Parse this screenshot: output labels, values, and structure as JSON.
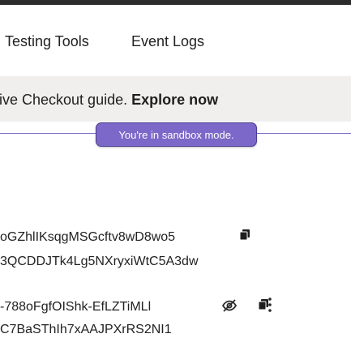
{
  "nav": {
    "items": [
      {
        "label": "Testing Tools"
      },
      {
        "label": "Event Logs"
      }
    ]
  },
  "banner": {
    "text": "tive Checkout guide.",
    "link": "Explore now"
  },
  "sandbox": {
    "label": "You're in sandbox mode."
  },
  "rows": [
    {
      "line1": "oGZhlIKsqgMSGcftv8wD8wo5",
      "line2": "3QCDDJTk4Lg5NXryxiWtC5A3dw"
    },
    {
      "line1": "-788oFgfOIShk-EfLZTiMLl",
      "line2": "C7BaSThIh7xAAJPXrRS2NI1"
    }
  ],
  "icons": {
    "copy": "copy-icon",
    "hide": "eye-off-icon",
    "more": "kebab-menu-icon"
  },
  "colors": {
    "sandbox": "#7b68c8",
    "banner_bg": "#f1efee",
    "topbar": "#2b2b2b"
  }
}
